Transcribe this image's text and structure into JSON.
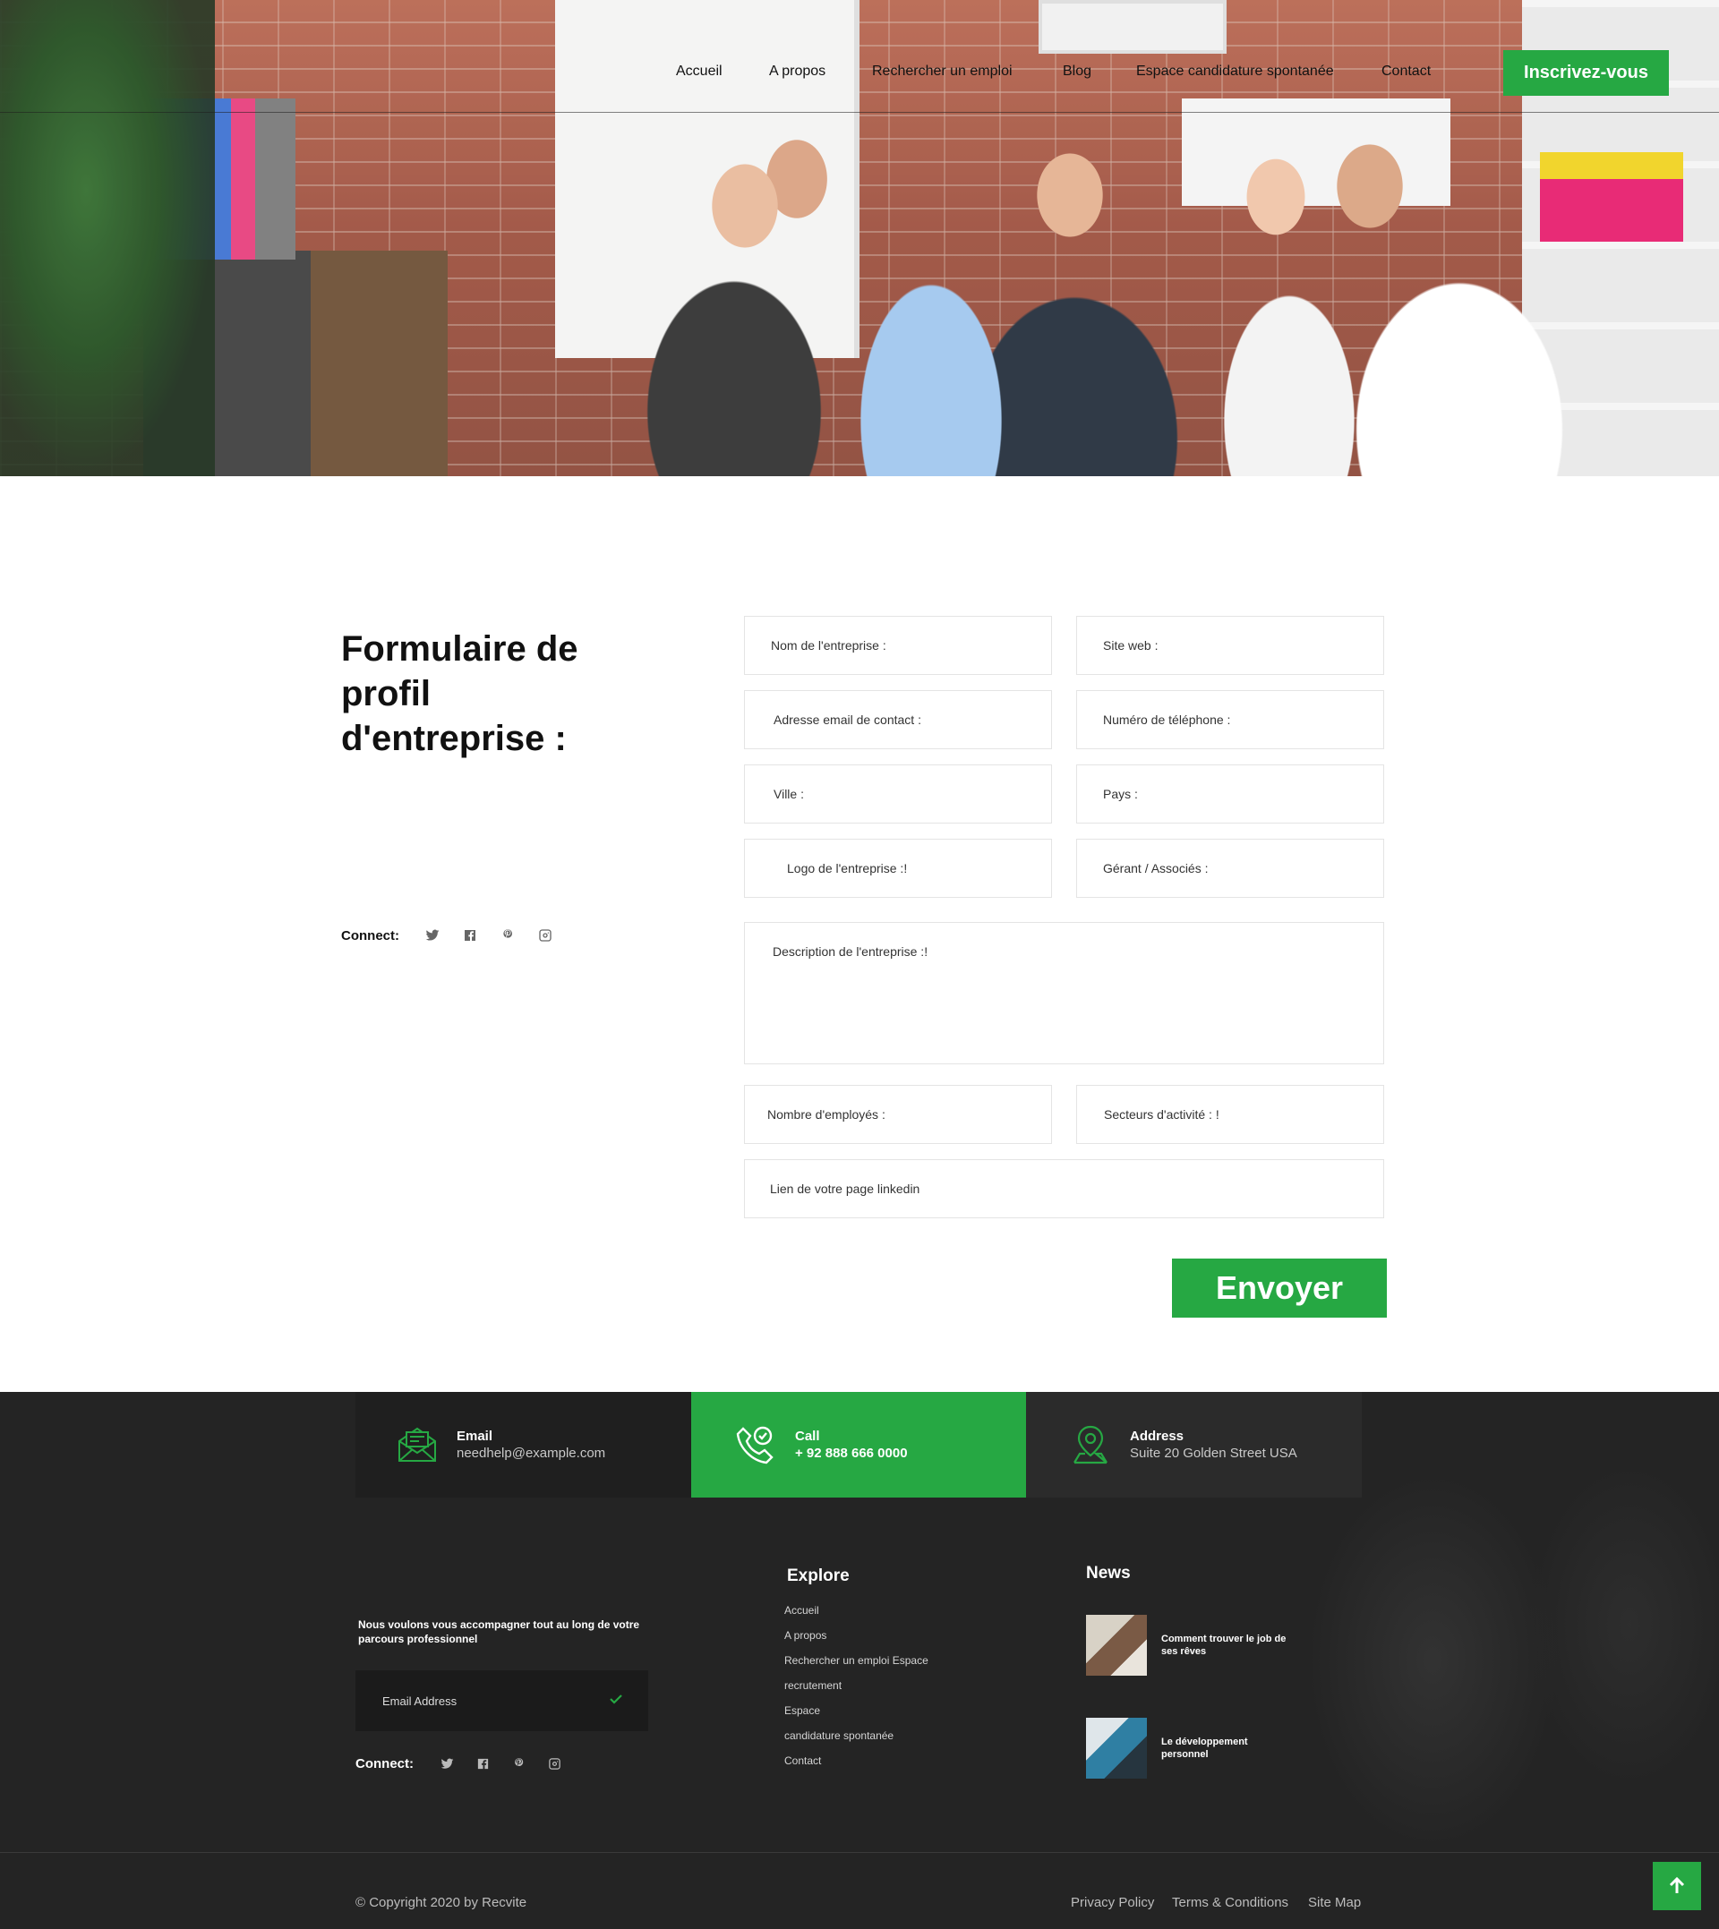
{
  "nav": {
    "items": [
      "Accueil",
      "A propos",
      "Rechercher un emploi",
      "Blog",
      "Espace candidature spontanée",
      "Contact"
    ],
    "cta": "Inscrivez-vous"
  },
  "form": {
    "title": "Formulaire de profil d'entreprise :",
    "connect_label": "Connect:",
    "fields": {
      "company_name": "Nom de l'entreprise :",
      "website": "Site web :",
      "contact_email": "Adresse email de contact :",
      "phone": "Numéro de téléphone :",
      "city": "Ville :",
      "country": "Pays :",
      "logo": "Logo de l'entreprise :!",
      "manager": "Gérant / Associés :",
      "description": "Description de l'entreprise :!",
      "employees": "Nombre d'employés :",
      "sectors": "Secteurs d'activité : !",
      "linkedin": "Lien de votre page linkedin"
    },
    "submit": "Envoyer"
  },
  "contact_bar": {
    "email": {
      "title": "Email",
      "value": "needhelp@example.com"
    },
    "call": {
      "title": "Call",
      "value": "+ 92 888 666 0000"
    },
    "address": {
      "title": "Address",
      "value": "Suite 20 Golden Street USA"
    }
  },
  "footer": {
    "tagline": "Nous voulons vous accompagner tout au long de votre parcours professionnel",
    "email_placeholder": "Email Address",
    "connect_label": "Connect:",
    "explore_title": "Explore",
    "explore_items": [
      "Accueil",
      "A propos",
      "Rechercher un emploi Espace",
      "recrutement",
      "Espace",
      "candidature spontanée",
      "Contact"
    ],
    "news_title": "News",
    "news": [
      "Comment trouver le job de ses rêves",
      "Le développement personnel"
    ],
    "copyright": "© Copyright 2020 by Recvite",
    "legal": [
      "Privacy Policy",
      "Terms & Conditions",
      "Site Map"
    ]
  },
  "colors": {
    "accent": "#26a843",
    "footer_bg": "#242424"
  },
  "icons": [
    "twitter-icon",
    "facebook-icon",
    "pinterest-icon",
    "instagram-icon",
    "email-icon",
    "phone-icon",
    "location-icon",
    "check-icon",
    "arrow-up-icon"
  ]
}
